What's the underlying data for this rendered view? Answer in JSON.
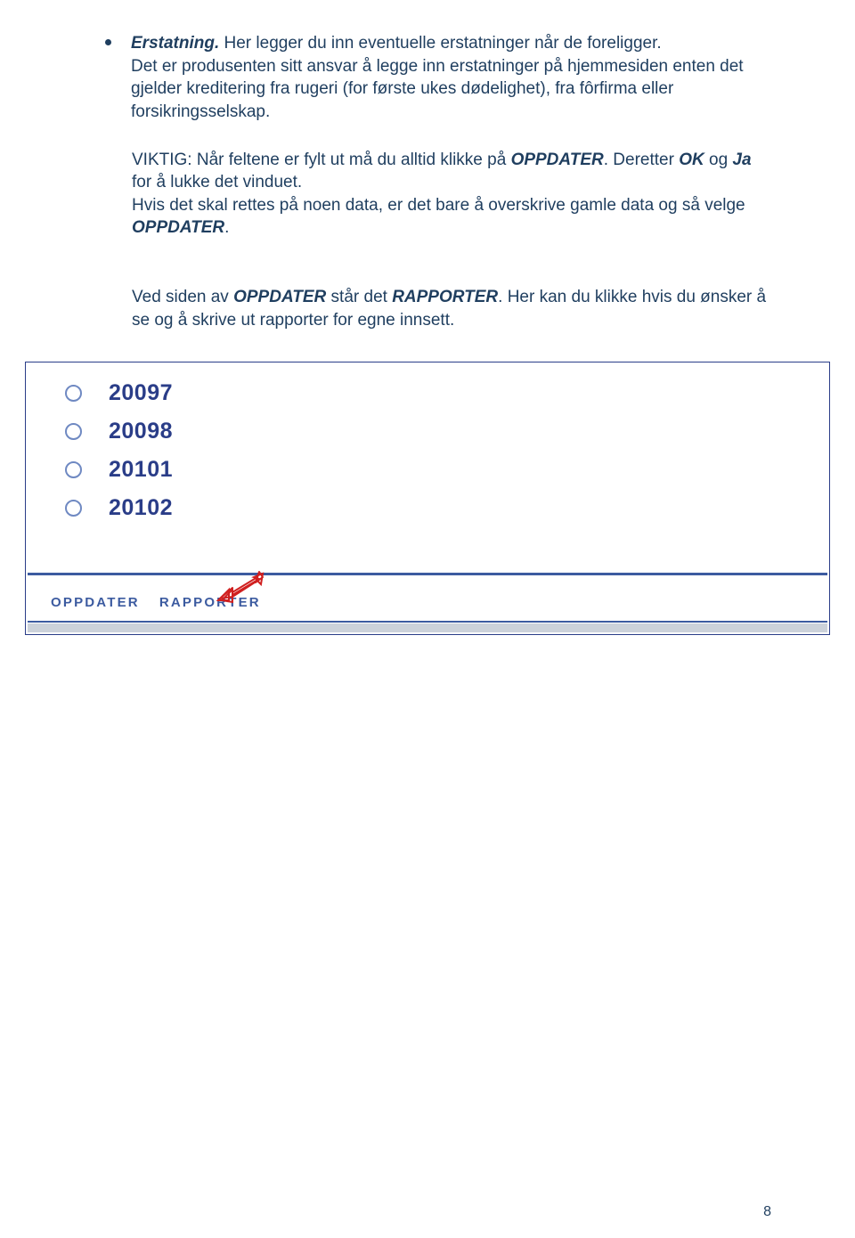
{
  "bullet": {
    "title": "Erstatning.",
    "line1_rest": " Her legger du inn eventuelle erstatninger når de foreligger.",
    "line2": "Det er produsenten sitt ansvar å legge inn erstatninger på hjemmesiden enten det gjelder kreditering fra rugeri (for første ukes dødelighet), fra fôrfirma eller forsikringsselskap."
  },
  "para1": {
    "pre": "VIKTIG: Når  feltene er fylt ut må du alltid klikke på ",
    "b1": "OPPDATER",
    "p1": ". Deretter ",
    "b2": "OK",
    "p2": " og ",
    "b3": "Ja",
    "p3": " for å lukke det vinduet.",
    "line3a": "Hvis det skal rettes på noen data, er det bare å overskrive gamle data og så  velge ",
    "line3b": "OPPDATER",
    "line3c": "."
  },
  "para2": {
    "pre": "Ved siden av ",
    "b1": "OPPDATER",
    "mid": " står det  ",
    "b2": "RAPPORTER",
    "post": ". Her kan du klikke hvis du ønsker å se og å skrive ut rapporter for egne innsett."
  },
  "radios": {
    "items": [
      "20097",
      "20098",
      "20101",
      "20102"
    ]
  },
  "buttons": {
    "oppdater": "OPPDATER",
    "rapporter": "RAPPORTER"
  },
  "page_number": "8"
}
